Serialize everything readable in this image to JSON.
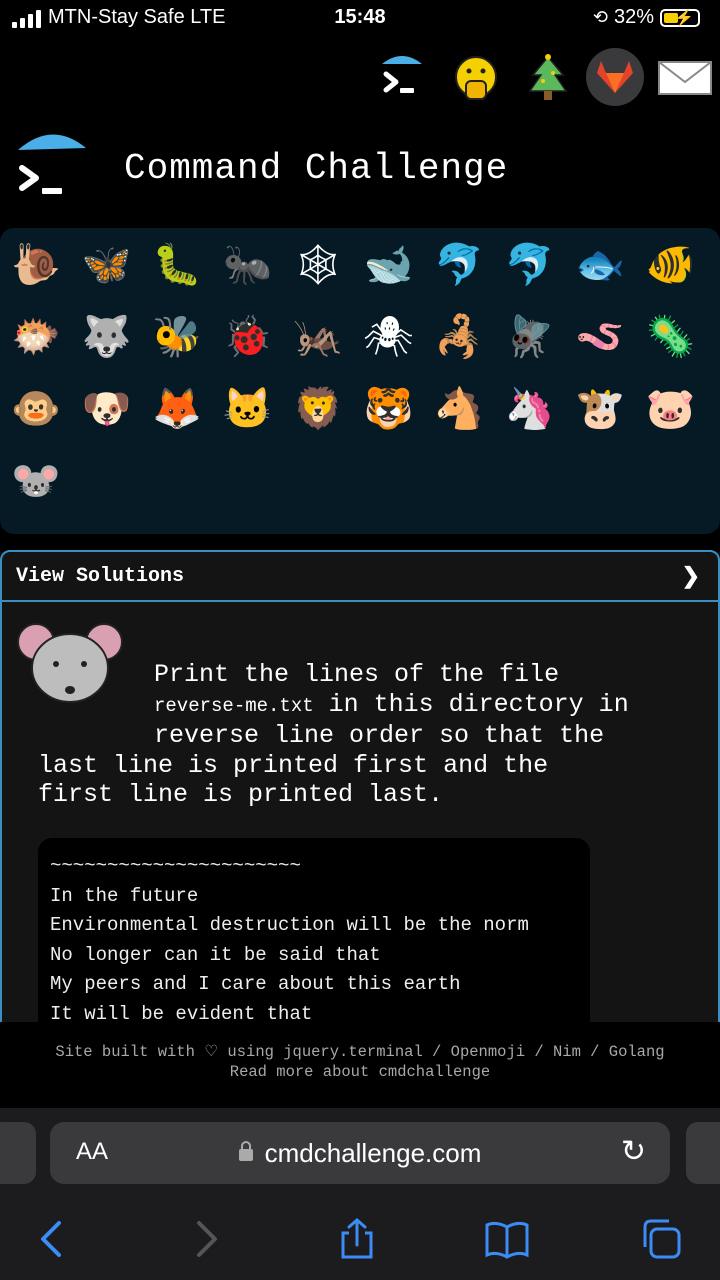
{
  "status_bar": {
    "carrier": "MTN-Stay Safe  LTE",
    "time": "15:48",
    "battery": "32%"
  },
  "top_icons": [
    "terminal-icon",
    "face-with-hand-over-mouth-icon",
    "christmas-tree-icon",
    "gitlab-icon",
    "envelope-icon"
  ],
  "header": {
    "title": "Command Challenge"
  },
  "emoji_grid": {
    "items": [
      "🐌",
      "🦋",
      "🐛",
      "🐜",
      "🕸",
      "🐋",
      "🐬",
      "🐬",
      "🐟",
      "🐠",
      "🐡",
      "🐺",
      "🐝",
      "🐞",
      "🦗",
      "🕷",
      "🦂",
      "🪰",
      "🪱",
      "🦠",
      "🐵",
      "🐶",
      "🦊",
      "🐱",
      "🦁",
      "🐯",
      "🐴",
      "🦄",
      "🐮",
      "🐷",
      "🐭"
    ]
  },
  "solutions": {
    "label": "View Solutions",
    "chevron": "❯"
  },
  "challenge": {
    "line1": "Print the lines of the file",
    "filename": "reverse-me.txt",
    "line2_rest": " in this directory in",
    "line3": "reverse line order so that the",
    "line4": "last line is printed first and the",
    "line5": "first line is printed last."
  },
  "terminal": {
    "lines": [
      "~~~~~~~~~~~~~~~~~~~~~~",
      "In the future",
      "Environmental destruction will be the norm",
      "No longer can it be said that",
      "My peers and I care about this earth",
      "It will be evident that"
    ]
  },
  "footer": {
    "line1": "Site built with ♡ using jquery.terminal / Openmoji / Nim / Golang",
    "line2": "Read more about cmdchallenge"
  },
  "browser": {
    "aa_label": "AA",
    "url": "cmdchallenge.com"
  },
  "colors": {
    "accent": "#3b8cf5",
    "panel": "#061a26",
    "border": "#3a8fc0",
    "umbrella": "#4aaee8"
  }
}
